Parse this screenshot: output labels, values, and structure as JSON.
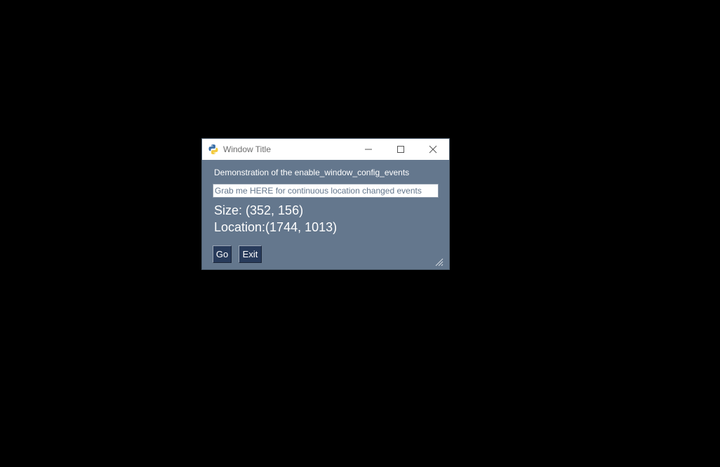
{
  "window": {
    "title": "Window Title",
    "app_icon": "python-logo-icon"
  },
  "titlebar_buttons": {
    "minimize": "minimize-icon",
    "maximize": "maximize-icon",
    "close": "close-icon"
  },
  "content": {
    "description": "Demonstration of the enable_window_config_events",
    "grab_input_value": "Grab me HERE for continuous location changed events",
    "size_text": "Size: (352, 156)",
    "location_text": "Location:(1744, 1013)"
  },
  "buttons": {
    "go_label": "Go",
    "exit_label": "Exit"
  },
  "colors": {
    "background": "#64778d",
    "button_bg": "#283b5b",
    "text": "#ffffff"
  }
}
